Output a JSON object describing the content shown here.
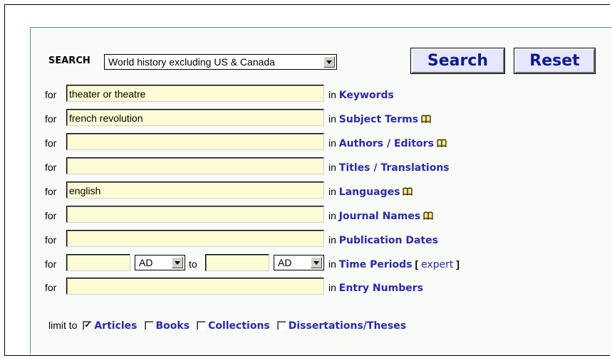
{
  "search": {
    "label": "SEARCH",
    "database_selected": "World history excluding US & Canada",
    "search_button": "Search",
    "reset_button": "Reset"
  },
  "rows": [
    {
      "for_label": "for",
      "value": "theater or theatre",
      "in_prefix": "in",
      "field_name": "Keywords",
      "has_book_icon": false
    },
    {
      "for_label": "for",
      "value": "french revolution",
      "in_prefix": "in",
      "field_name": "Subject Terms",
      "has_book_icon": true
    },
    {
      "for_label": "for",
      "value": "",
      "in_prefix": "in",
      "field_name": "Authors / Editors",
      "has_book_icon": true
    },
    {
      "for_label": "for",
      "value": "",
      "in_prefix": "in",
      "field_name": "Titles / Translations",
      "has_book_icon": false
    },
    {
      "for_label": "for",
      "value": "english",
      "in_prefix": "in",
      "field_name": "Languages",
      "has_book_icon": true
    },
    {
      "for_label": "for",
      "value": "",
      "in_prefix": "in",
      "field_name": "Journal Names",
      "has_book_icon": true
    },
    {
      "for_label": "for",
      "value": "",
      "in_prefix": "in",
      "field_name": "Publication Dates",
      "has_book_icon": false
    }
  ],
  "time_periods": {
    "for_label": "for",
    "from_value": "",
    "from_era": "AD",
    "to_label": "to",
    "to_value": "",
    "to_era": "AD",
    "in_prefix": "in",
    "field_name": "Time Periods",
    "bracket_open": "[",
    "expert_link": "expert",
    "bracket_close": "]"
  },
  "entry_numbers": {
    "for_label": "for",
    "value": "",
    "in_prefix": "in",
    "field_name": "Entry Numbers"
  },
  "limit": {
    "label": "limit to",
    "options": [
      {
        "label": "Articles",
        "checked": true
      },
      {
        "label": "Books",
        "checked": false
      },
      {
        "label": "Collections",
        "checked": false
      },
      {
        "label": "Dissertations/Theses",
        "checked": false
      }
    ]
  },
  "colors": {
    "field_bg": "#fefcd4",
    "link": "#2b2ba3",
    "button_bg": "#e7e7fb",
    "button_text": "#0d1a8f"
  },
  "icons": {
    "book": "open-book-icon",
    "dropdown": "chevron-down-icon",
    "checkbox": "checkmark-icon"
  }
}
